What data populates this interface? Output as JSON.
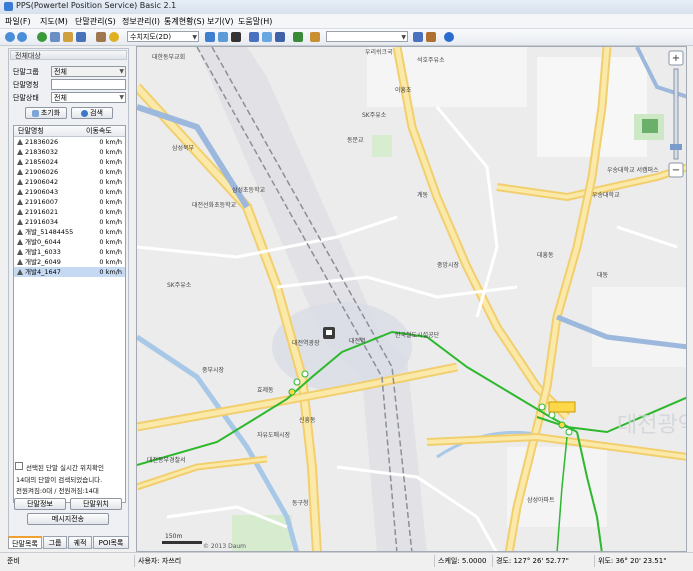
{
  "window": {
    "title": "PPS(Powertel Position Service) Basic 2.1"
  },
  "menu": [
    "파일(F)",
    "지도(M)",
    "단말관리(S)",
    "정보관리(I)",
    "통계현황(S)",
    "보기(V)",
    "도움말(H)"
  ],
  "toolbar": {
    "map_type": "수치지도(2D)",
    "search_value": ""
  },
  "panel": {
    "title": "전체대상",
    "group_label": "단말그룹",
    "group_value": "전체",
    "name_label": "단말명칭",
    "name_value": "",
    "status_label": "단말상태",
    "status_value": "전체",
    "reset_button": "초기화",
    "search_button": "검색",
    "col_name": "단말명칭",
    "col_speed": "이동속도",
    "devices": [
      {
        "name": "21836026",
        "speed": "0 km/h"
      },
      {
        "name": "21836032",
        "speed": "0 km/h"
      },
      {
        "name": "21856024",
        "speed": "0 km/h"
      },
      {
        "name": "21906026",
        "speed": "0 km/h"
      },
      {
        "name": "21906042",
        "speed": "0 km/h"
      },
      {
        "name": "21906043",
        "speed": "0 km/h"
      },
      {
        "name": "21916007",
        "speed": "0 km/h"
      },
      {
        "name": "21916021",
        "speed": "0 km/h"
      },
      {
        "name": "21916034",
        "speed": "0 km/h"
      },
      {
        "name": "개발_51484455",
        "speed": "0 km/h"
      },
      {
        "name": "개발0_6044",
        "speed": "0 km/h"
      },
      {
        "name": "개발1_6033",
        "speed": "0 km/h"
      },
      {
        "name": "개발2_6049",
        "speed": "0 km/h"
      },
      {
        "name": "개발4_1647",
        "speed": "0 km/h"
      }
    ],
    "realtime_check": "선택된 단말 실시간 위치확인",
    "found_msg": "14대의 단말이 검색되었습니다.",
    "counts_msg": "전원켜짐:0대 / 전원꺼짐:14대",
    "info_button": "단말정보",
    "locate_button": "단말위치",
    "message_button": "메시지전송"
  },
  "tabs": [
    "단말목록",
    "그룹",
    "궤적",
    "POI목록"
  ],
  "map": {
    "labels": {
      "sangsam": "삼성동",
      "woori": "우리쉬크국",
      "seoknam": "석호주유소",
      "dongbu": "대한동부교회",
      "ilheung": "이흥초",
      "sk": "SK주유소",
      "sambuk": "삼성북부",
      "dongmun": "동문교",
      "daejeon_elem": "대전선화초등학교",
      "samsung_school": "삼성초등학교",
      "daejeon_station": "대전역",
      "korail": "한국철도시설공단",
      "gyedong": "계동",
      "station_sq": "대전역광장",
      "wooseong": "우송대학교",
      "wooseong2": "우송대학교 서캠퍼스",
      "daedong": "대동",
      "daeheung": "대흥동",
      "joongbu": "중부시장",
      "jayu": "자유도매시장",
      "dongpo": "동구청",
      "jungang": "중앙시장",
      "incheon": "대전동부경찰서",
      "hyoje": "효제동",
      "sinheung": "신흥동",
      "samseong_apt": "삼성아파트",
      "sound": "대전광역시",
      "scale": "150m",
      "copyright": "© 2013 Daum"
    }
  },
  "status": {
    "ready": "준비",
    "user": "사용자: 자쓰리",
    "scale": "스케일: 5.0000",
    "longitude": "경도: 127° 26' 52.77\"",
    "latitude": "위도: 36° 20' 23.51\""
  },
  "colors": {
    "route": "#2db82d",
    "highlight": "#ffd84a",
    "selection": "#c5d9f2"
  }
}
